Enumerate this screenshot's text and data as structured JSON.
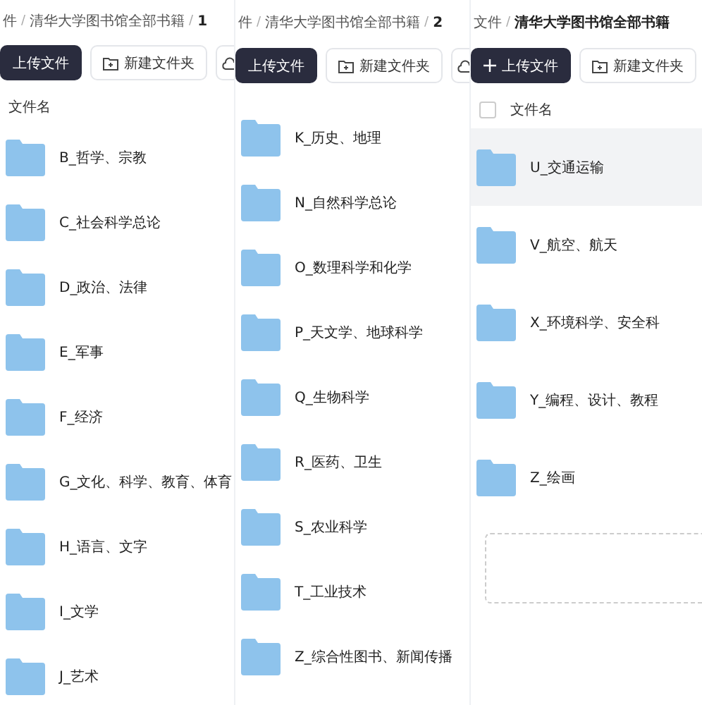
{
  "panels": [
    {
      "separator": "/",
      "breadcrumb": [
        "件",
        "清华大学图书馆全部书籍",
        "1"
      ],
      "buttons": [
        {
          "kind": "primary",
          "label": "上传文件"
        },
        {
          "kind": "folder",
          "label": "新建文件夹"
        },
        {
          "kind": "icon"
        }
      ],
      "header": {
        "label": "文件名"
      },
      "rows": [
        {
          "name": "B_哲学、宗教",
          "selected": false
        },
        {
          "name": "C_社会科学总论",
          "selected": false
        },
        {
          "name": "D_政治、法律",
          "selected": false
        },
        {
          "name": "E_军事",
          "selected": false
        },
        {
          "name": "F_经济",
          "selected": false
        },
        {
          "name": "G_文化、科学、教育、体育",
          "selected": false
        },
        {
          "name": "H_语言、文字",
          "selected": false
        },
        {
          "name": "I_文学",
          "selected": false
        },
        {
          "name": "J_艺术",
          "selected": false
        }
      ]
    },
    {
      "separator": "/",
      "breadcrumb": [
        "件",
        "清华大学图书馆全部书籍",
        "2"
      ],
      "buttons": [
        {
          "kind": "primary",
          "label": "上传文件"
        },
        {
          "kind": "folder",
          "label": "新建文件夹"
        },
        {
          "kind": "icon"
        }
      ],
      "rows": [
        {
          "name": "K_历史、地理",
          "selected": false
        },
        {
          "name": "N_自然科学总论",
          "selected": false
        },
        {
          "name": "O_数理科学和化学",
          "selected": false
        },
        {
          "name": "P_天文学、地球科学",
          "selected": false
        },
        {
          "name": "Q_生物科学",
          "selected": false
        },
        {
          "name": "R_医药、卫生",
          "selected": false
        },
        {
          "name": "S_农业科学",
          "selected": false
        },
        {
          "name": "T_工业技术",
          "selected": false
        },
        {
          "name": "Z_综合性图书、新闻传播",
          "selected": false
        }
      ]
    },
    {
      "separator": "/",
      "breadcrumb": [
        "文件",
        "清华大学图书馆全部书籍"
      ],
      "buttons": [
        {
          "kind": "primary",
          "label": "上传文件",
          "plus": true
        },
        {
          "kind": "folder",
          "label": "新建文件夹"
        }
      ],
      "header": {
        "label": "文件名",
        "checkbox": {
          "checked": false
        }
      },
      "rows": [
        {
          "name": "U_交通运输",
          "selected": true
        },
        {
          "name": "V_航空、航天",
          "selected": false
        },
        {
          "name": "X_环境科学、安全科",
          "selected": false
        },
        {
          "name": "Y_编程、设计、教程",
          "selected": false
        },
        {
          "name": "Z_绘画",
          "selected": false
        }
      ],
      "dropzone": true
    }
  ]
}
